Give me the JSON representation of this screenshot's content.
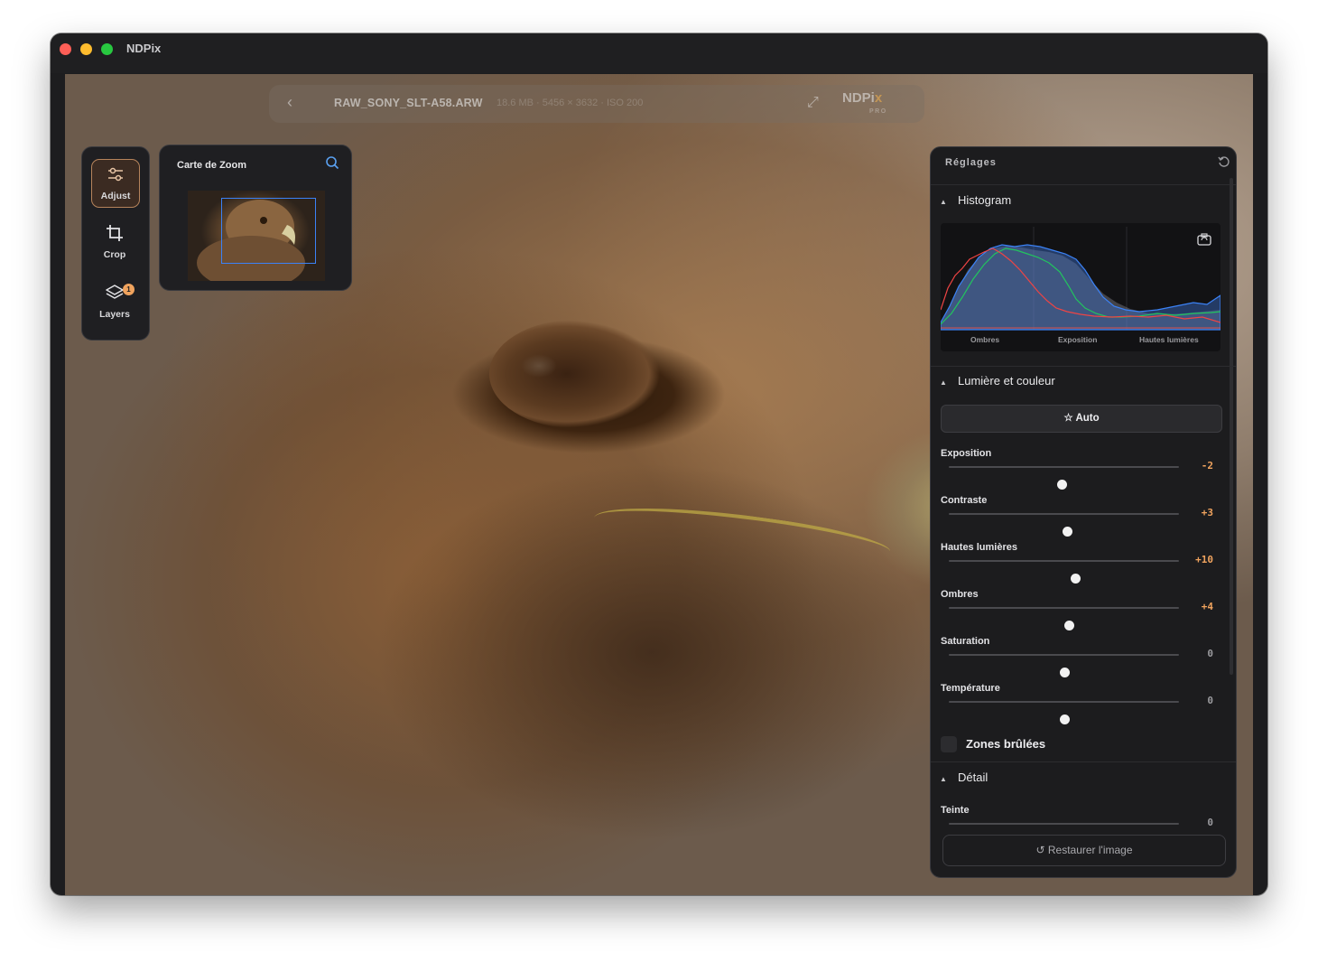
{
  "window": {
    "title": "NDPix"
  },
  "filebar": {
    "back_icon": "chevron-left-icon",
    "filename": "RAW_SONY_SLT-A58.ARW",
    "meta": "18.6 MB · 5456 × 3632 · ISO 200",
    "logo_main": "NDPi",
    "logo_x": "x",
    "logo_sub": "PRO"
  },
  "tools": [
    {
      "label": "Adjust",
      "icon": "sliders-icon",
      "active": true
    },
    {
      "label": "Crop",
      "icon": "crop-icon",
      "active": false
    },
    {
      "label": "Layers",
      "icon": "layers-icon",
      "active": false,
      "badge": "1"
    }
  ],
  "zoom_map": {
    "title": "Carte de Zoom"
  },
  "panel": {
    "title": "Réglages",
    "histogram": {
      "title": "Histogram",
      "labels": [
        "Ombres",
        "Exposition",
        "Hautes lumières"
      ]
    },
    "light_color": {
      "title": "Lumière et couleur",
      "auto_label": "Auto",
      "sliders": [
        {
          "label": "Exposition",
          "value": "-2",
          "position": 0.49
        },
        {
          "label": "Contraste",
          "value": "+3",
          "position": 0.515
        },
        {
          "label": "Hautes lumières",
          "value": "+10",
          "position": 0.55
        },
        {
          "label": "Ombres",
          "value": "+4",
          "position": 0.52
        },
        {
          "label": "Saturation",
          "value": "0",
          "position": 0.5
        },
        {
          "label": "Température",
          "value": "0",
          "position": 0.5
        }
      ]
    },
    "burned_zones": {
      "label": "Zones brûlées",
      "checked": false
    },
    "detail": {
      "title": "Détail",
      "sliders": [
        {
          "label": "Teinte",
          "value": "0",
          "position": 0.5
        }
      ]
    },
    "restore_label": "Restaurer l'image"
  },
  "colors": {
    "accent": "#f0a35e",
    "selection": "#3b82f6"
  }
}
